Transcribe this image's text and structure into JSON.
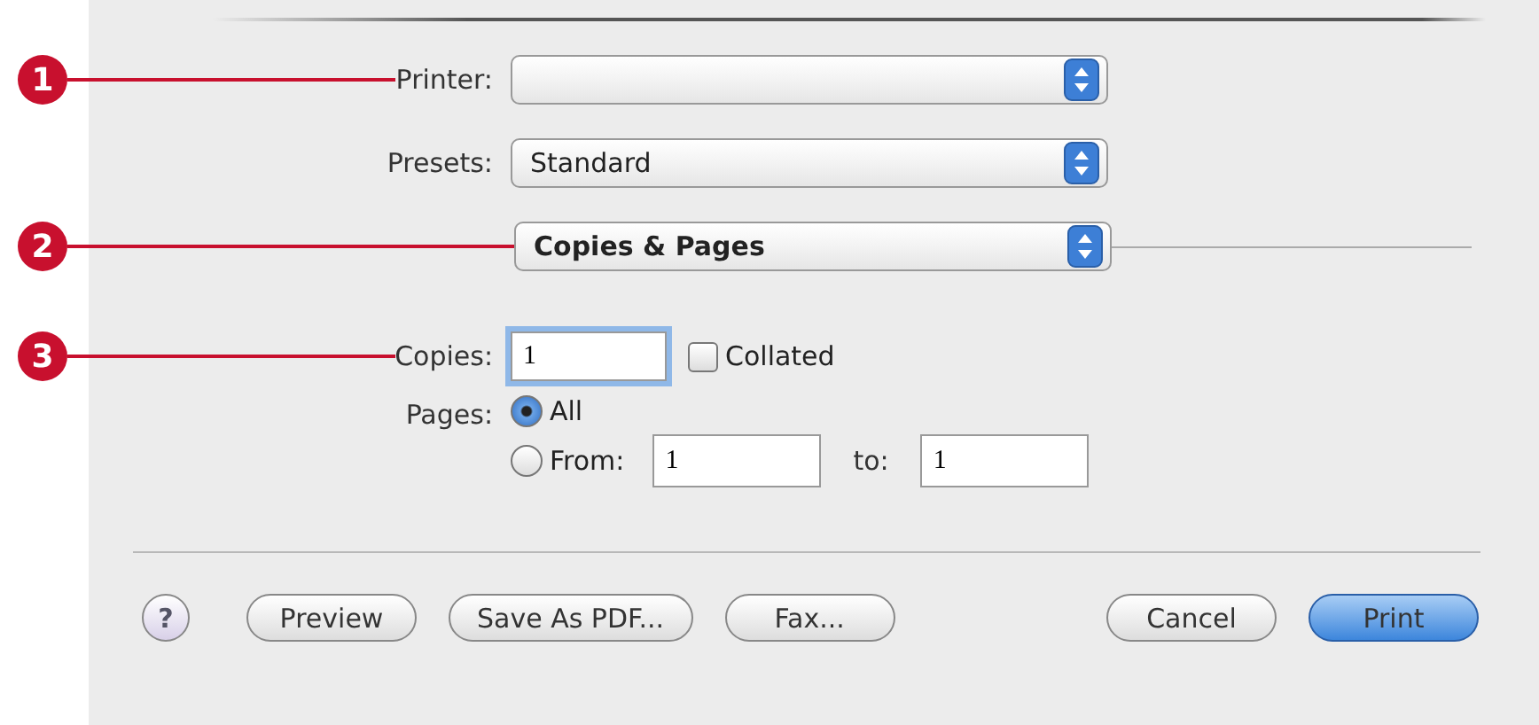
{
  "printer": {
    "callout": "1",
    "label": "Printer:"
  },
  "presets": {
    "label": "Presets:",
    "value": "Standard"
  },
  "panel_menu": {
    "callout": "2",
    "value": "Copies & Pages"
  },
  "copies": {
    "callout": "3",
    "label": "Copies:",
    "value": "1",
    "collated": {
      "label": "Collated",
      "checked": false
    }
  },
  "pages": {
    "label": "Pages:",
    "options": [
      {
        "label": "All",
        "selected": true
      },
      {
        "label": "From:",
        "selected": false
      }
    ],
    "from": "1",
    "to_label": "to:",
    "to": "1"
  },
  "help_button": {
    "text": "?"
  },
  "left_buttons": [
    {
      "label": "Preview",
      "default": false
    },
    {
      "label": "Save As PDF...",
      "default": false
    },
    {
      "label": "Fax...",
      "default": false
    }
  ],
  "right_buttons": [
    {
      "label": "Cancel",
      "default": false
    },
    {
      "label": "Print",
      "default": true
    }
  ]
}
